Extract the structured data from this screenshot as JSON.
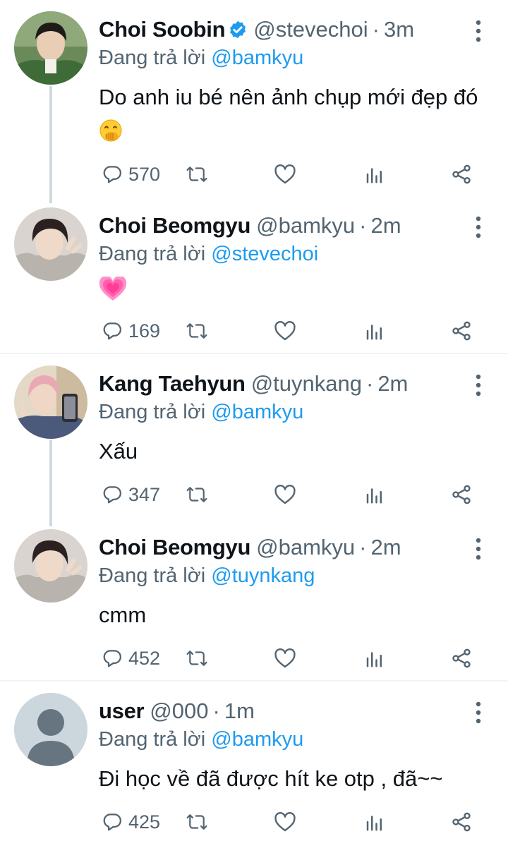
{
  "tweets": [
    {
      "name": "Choi Soobin",
      "handle": "@stevechoi",
      "dot": "·",
      "time": "3m",
      "replying_prefix": "Đang trả lời",
      "replying_to": "@bamkyu",
      "text": "Do anh iu bé nên ảnh chụp mới đẹp đó",
      "emoji": "face-with-hand-over-mouth",
      "replies": "570",
      "verified": true
    },
    {
      "name": "Choi Beomgyu",
      "handle": "@bamkyu",
      "dot": "·",
      "time": "2m",
      "replying_prefix": "Đang trả lời",
      "replying_to": "@stevechoi",
      "text": "",
      "emoji": "growing-heart",
      "replies": "169"
    },
    {
      "name": "Kang Taehyun",
      "handle": "@tuynkang",
      "dot": "·",
      "time": "2m",
      "replying_prefix": "Đang trả lời",
      "replying_to": "@bamkyu",
      "text": "Xấu",
      "replies": "347"
    },
    {
      "name": "Choi Beomgyu",
      "handle": "@bamkyu",
      "dot": "·",
      "time": "2m",
      "replying_prefix": "Đang trả lời",
      "replying_to": "@tuynkang",
      "text": "cmm",
      "replies": "452"
    },
    {
      "name": "user",
      "handle": "@000",
      "dot": "·",
      "time": "1m",
      "replying_prefix": "Đang trả lời",
      "replying_to": "@bamkyu",
      "text": "Đi học về đã được hít ke otp , đã~~",
      "replies": "425"
    }
  ],
  "colors": {
    "link": "#1d9bf0",
    "secondary": "#536471",
    "verified": "#1d9bf0",
    "divider": "#eff3f4"
  }
}
